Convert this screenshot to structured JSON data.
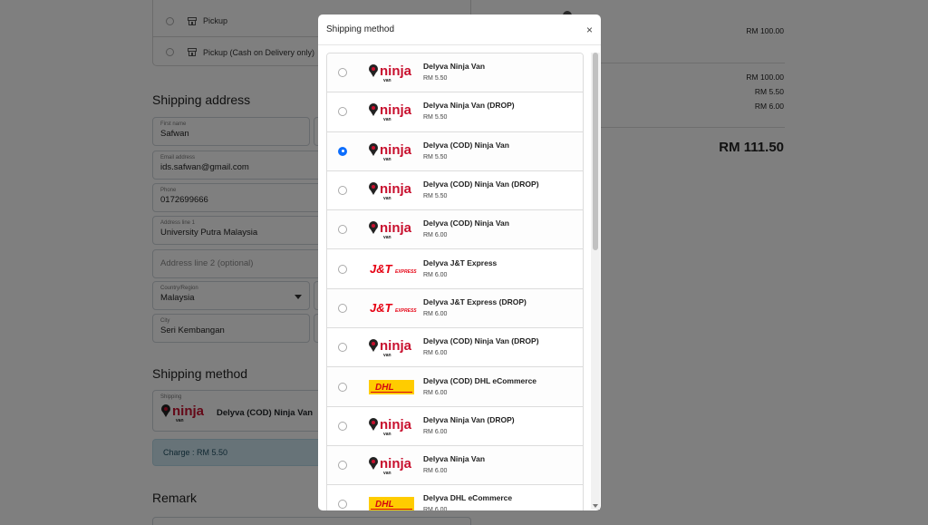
{
  "background": {
    "pickup_options": [
      {
        "label": "Pickup"
      },
      {
        "label": "Pickup (Cash on Delivery only)"
      }
    ],
    "shipping_address": {
      "title": "Shipping address",
      "first_name": {
        "label": "First name",
        "value": "Safwan"
      },
      "email": {
        "label": "Email address",
        "value": "ids.safwan@gmail.com"
      },
      "phone": {
        "label": "Phone",
        "value": "0172699666"
      },
      "address1": {
        "label": "Address line 1",
        "value": "University Putra Malaysia"
      },
      "address2": {
        "placeholder": "Address line 2 (optional)"
      },
      "country": {
        "label": "Country/Region",
        "value": "Malaysia"
      },
      "city": {
        "label": "City",
        "value": "Seri Kembangan"
      }
    },
    "shipping_method": {
      "title": "Shipping method",
      "label": "Shipping",
      "selected": "Delyva (COD) Ninja Van",
      "charge": "Charge : RM 5.50"
    },
    "remark": {
      "title": "Remark"
    },
    "summary": {
      "item_amount": "RM 100.00",
      "subtotal": "RM 100.00",
      "shipping": "RM 5.50",
      "other": "RM 6.00",
      "total": "RM 111.50"
    }
  },
  "modal": {
    "title": "Shipping method",
    "close_icon": "×",
    "options": [
      {
        "name": "Delyva Ninja Van",
        "price": "RM 5.50",
        "logo": "ninjavan",
        "checked": false
      },
      {
        "name": "Delyva Ninja Van (DROP)",
        "price": "RM 5.50",
        "logo": "ninjavan",
        "checked": false
      },
      {
        "name": "Delyva (COD) Ninja Van",
        "price": "RM 5.50",
        "logo": "ninjavan",
        "checked": true
      },
      {
        "name": "Delyva (COD) Ninja Van (DROP)",
        "price": "RM 5.50",
        "logo": "ninjavan",
        "checked": false
      },
      {
        "name": "Delyva (COD) Ninja Van",
        "price": "RM 6.00",
        "logo": "ninjavan",
        "checked": false
      },
      {
        "name": "Delyva J&T Express",
        "price": "RM 6.00",
        "logo": "jnt",
        "checked": false
      },
      {
        "name": "Delyva J&T Express (DROP)",
        "price": "RM 6.00",
        "logo": "jnt",
        "checked": false
      },
      {
        "name": "Delyva (COD) Ninja Van (DROP)",
        "price": "RM 6.00",
        "logo": "ninjavan",
        "checked": false
      },
      {
        "name": "Delyva (COD) DHL eCommerce",
        "price": "RM 6.00",
        "logo": "dhl",
        "checked": false
      },
      {
        "name": "Delyva Ninja Van (DROP)",
        "price": "RM 6.00",
        "logo": "ninjavan",
        "checked": false
      },
      {
        "name": "Delyva Ninja Van",
        "price": "RM 6.00",
        "logo": "ninjavan",
        "checked": false
      },
      {
        "name": "Delyva DHL eCommerce",
        "price": "RM 6.00",
        "logo": "dhl",
        "checked": false
      }
    ]
  },
  "colors": {
    "ninja_red": "#c8102e",
    "jnt_red": "#e60012",
    "dhl_yellow": "#ffcc00",
    "radio_blue": "#0d6efd"
  }
}
